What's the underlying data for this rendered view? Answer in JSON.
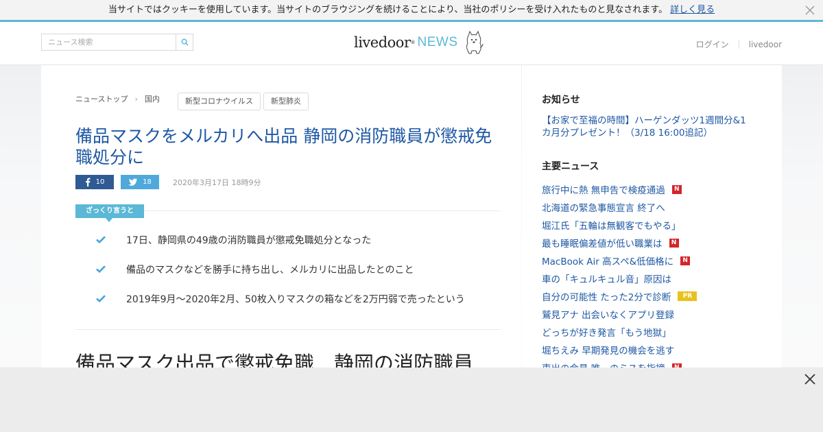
{
  "cookie_bar": {
    "text": "当サイトではクッキーを使用しています。当サイトのブラウジングを続けることにより、当社のポリシーを受け入れたものと見なされます。",
    "more_link": "詳しく見る"
  },
  "header": {
    "search_placeholder": "ニュース検索",
    "logo": {
      "brand": "livedoor",
      "superscript": "®",
      "product": "NEWS"
    },
    "links": [
      "ログイン",
      "livedoor"
    ]
  },
  "article": {
    "breadcrumb": [
      "ニューストップ",
      "国内"
    ],
    "tags": [
      "新型コロナウイルス",
      "新型肺炎"
    ],
    "title": "備品マスクをメルカリへ出品 静岡の消防職員が懲戒免職処分に",
    "share": {
      "facebook_count": "10",
      "twitter_count": "18"
    },
    "date": "2020年3月17日 18時9分",
    "summary_label": "ざっくり言うと",
    "summary": [
      "17日、静岡県の49歳の消防職員が懲戒免職処分となった",
      "備品のマスクなどを勝手に持ち出し、メルカリに出品したとのこと",
      "2019年9月～2020年2月、50枚入りマスクの箱などを2万円弱で売ったという"
    ],
    "sub_headline": "備品マスク出品で懲戒免職　静岡の消防職員"
  },
  "sidebar": {
    "notice_heading": "お知らせ",
    "notice_link": "【お家で至福の時間】ハーゲンダッツ1週間分&1カ月分プレゼント！（3/18 16:00追記）",
    "news_heading": "主要ニュース",
    "news": [
      {
        "title": "旅行中に熱 無申告で検疫通過",
        "badge": "N"
      },
      {
        "title": "北海道の緊急事態宣言 終了へ",
        "badge": ""
      },
      {
        "title": "堀江氏「五輪は無観客でもやる」",
        "badge": ""
      },
      {
        "title": "最も睡眠偏差値が低い職業は",
        "badge": "N"
      },
      {
        "title": "MacBook Air 高スペ&低価格に",
        "badge": "N"
      },
      {
        "title": "車の「キュルキュル音」原因は",
        "badge": ""
      },
      {
        "title": "自分の可能性 たった2分で診断",
        "badge": "PR"
      },
      {
        "title": "鷲見アナ 出会いなくアプリ登録",
        "badge": ""
      },
      {
        "title": "どっちが好き発言「もう地獄」",
        "badge": ""
      },
      {
        "title": "堀ちえみ 早期発見の機会を逃す",
        "badge": ""
      },
      {
        "title": "東出の会見 唯一のミスを指摘",
        "badge": "N"
      }
    ]
  },
  "colors": {
    "accent": "#5bb8d6",
    "link": "#1e58a4",
    "facebook": "#2f5a94",
    "twitter": "#4fa9db",
    "badge_new": "#d5252b",
    "badge_pr": "#e8c21d"
  },
  "icons": [
    "close-icon",
    "search-icon",
    "dog-mascot-icon",
    "facebook-icon",
    "twitter-icon",
    "check-icon"
  ]
}
